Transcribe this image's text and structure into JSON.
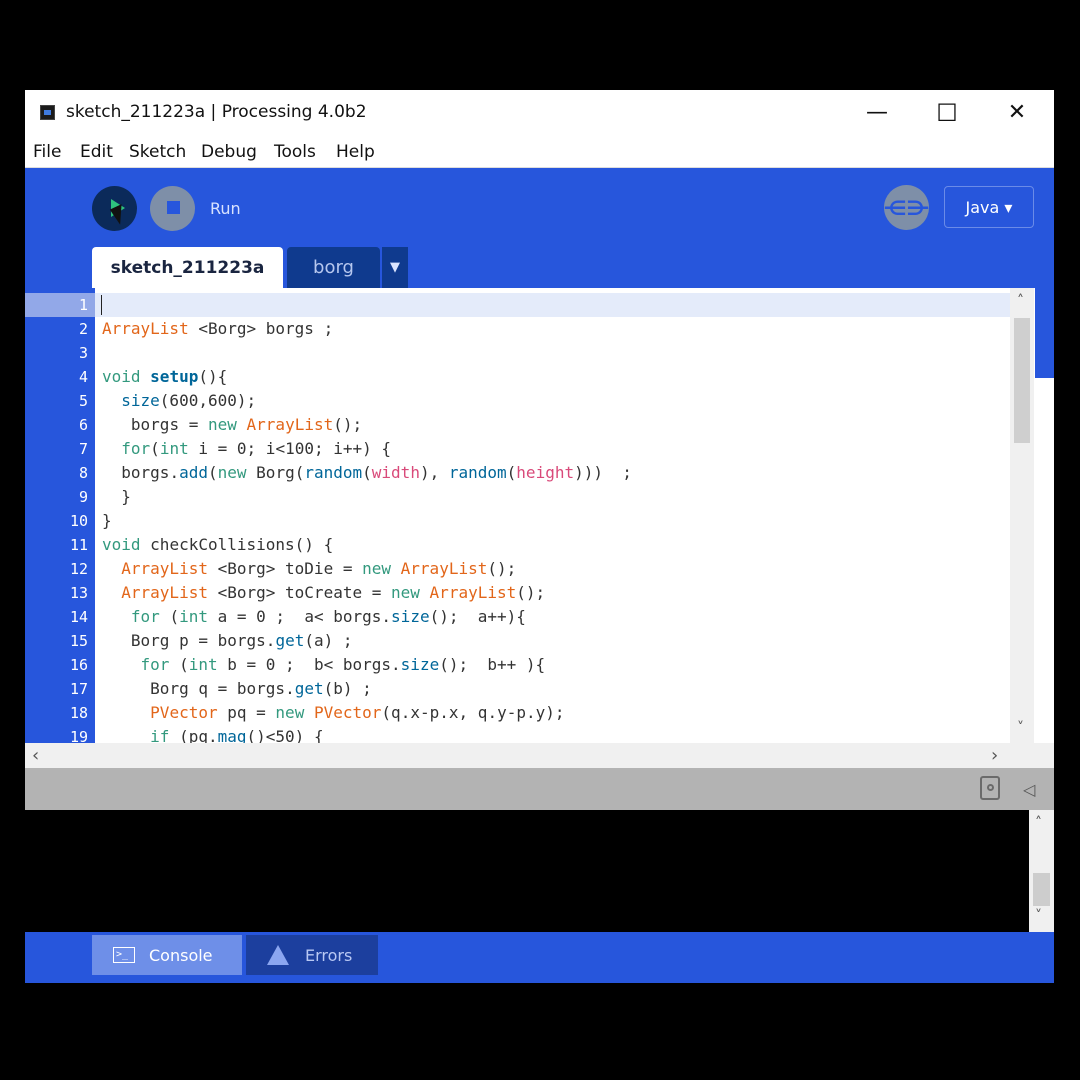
{
  "window": {
    "title": "sketch_211223a | Processing 4.0b2",
    "controls": {
      "minimize": "—",
      "maximize": "☐",
      "close": "✕"
    }
  },
  "menu": [
    "File",
    "Edit",
    "Sketch",
    "Debug",
    "Tools",
    "Help"
  ],
  "toolbar": {
    "run_label": "Run",
    "mode_label": "Java ▾",
    "debug_icon": "debugger-butterfly-icon"
  },
  "tabs": [
    {
      "label": "sketch_211223a",
      "active": true
    },
    {
      "label": "borg",
      "active": false
    }
  ],
  "tab_dropdown": "▼",
  "editor": {
    "line_numbers": [
      "1",
      "2",
      "3",
      "4",
      "5",
      "6",
      "7",
      "8",
      "9",
      "10",
      "11",
      "12",
      "13",
      "14",
      "15",
      "16",
      "17",
      "18",
      "19"
    ],
    "lines": [
      "",
      "ArrayList <Borg> borgs ;",
      "",
      "void setup(){",
      "  size(600,600);",
      "   borgs = new ArrayList();",
      "  for(int i = 0; i<100; i++) {",
      "  borgs.add(new Borg(random(width), random(height)))  ;",
      "  }",
      "}",
      "void checkCollisions() {",
      "  ArrayList <Borg> toDie = new ArrayList();",
      "  ArrayList <Borg> toCreate = new ArrayList();",
      "   for (int a = 0 ;  a< borgs.size();  a++){",
      "   Borg p = borgs.get(a) ;",
      "    for (int b = 0 ;  b< borgs.size();  b++ ){",
      "     Borg q = borgs.get(b) ;",
      "     PVector pq = new PVector(q.x-p.x, q.y-p.y);",
      "     if (pq.mag()<50) {"
    ]
  },
  "scroll": {
    "up": "˄",
    "down": "˅",
    "left": "‹",
    "right": "›"
  },
  "status": {
    "collapse": "◁"
  },
  "bottom_tabs": {
    "console": "Console",
    "errors": "Errors"
  },
  "colors": {
    "accent": "#2756dc",
    "keyword": "#33997e",
    "type": "#e2661a",
    "function": "#006699"
  }
}
